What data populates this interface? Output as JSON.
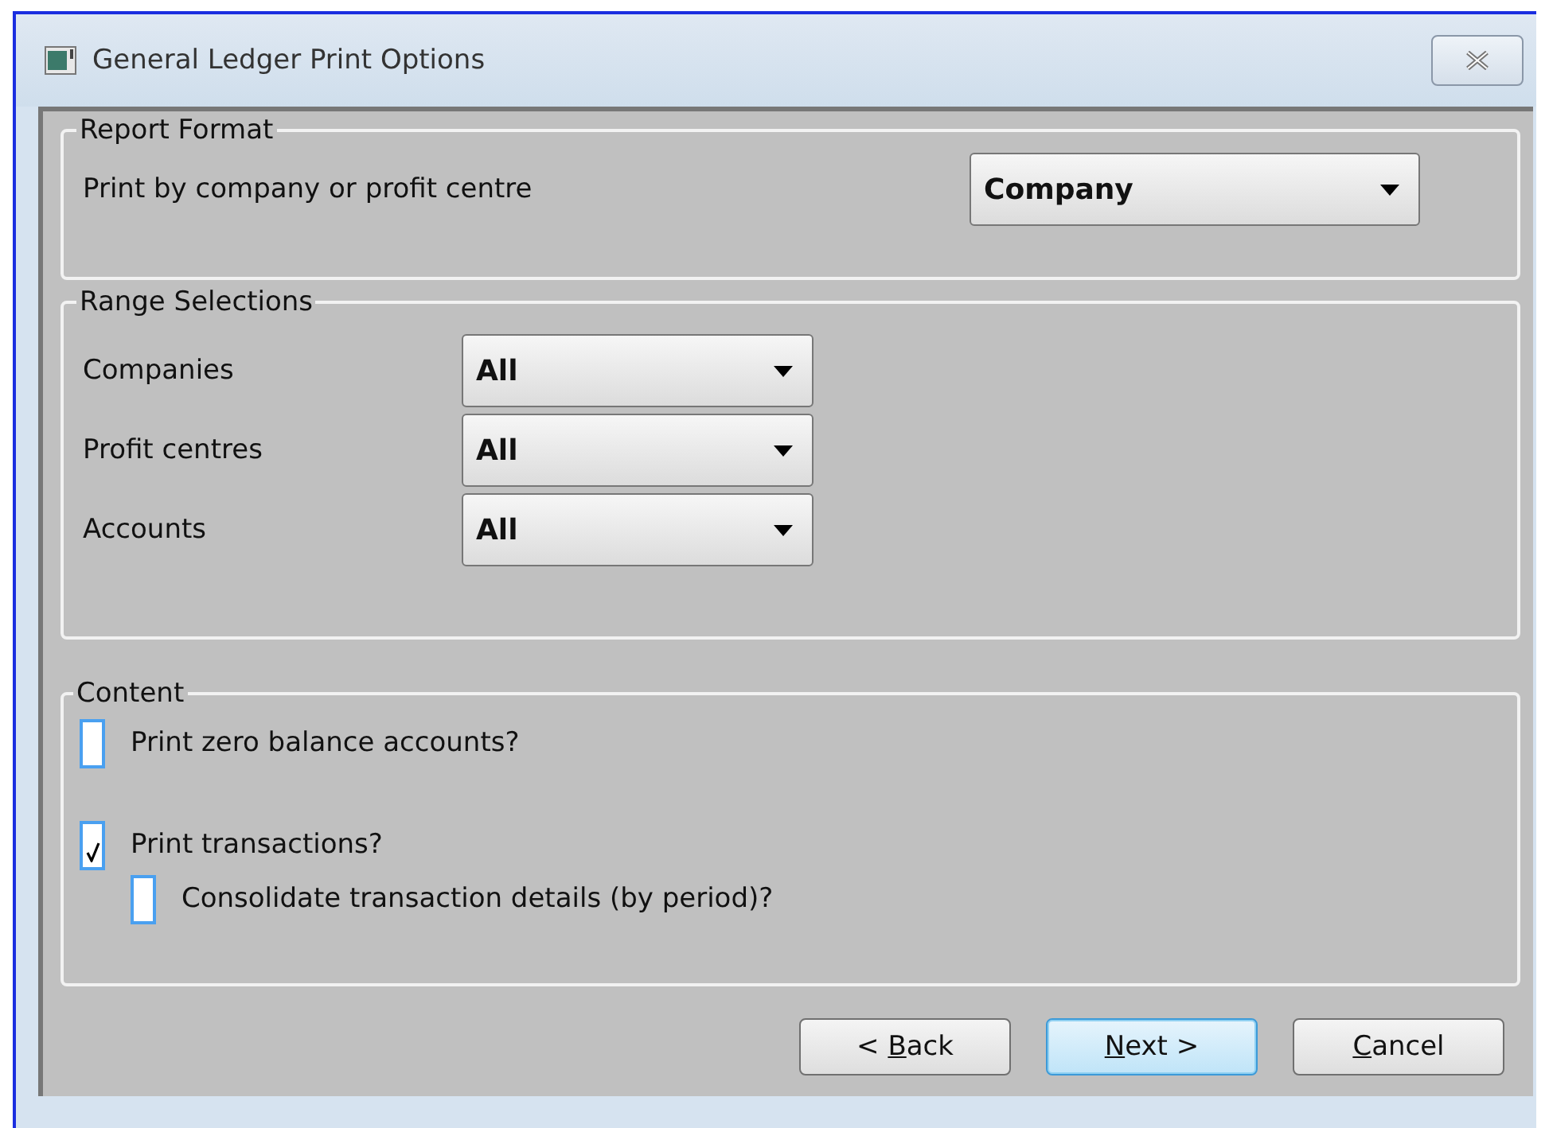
{
  "window": {
    "title": "General Ledger Print Options"
  },
  "report_format": {
    "title": "Report Format",
    "label": "Print by company or profit centre",
    "value": "Company"
  },
  "range_selections": {
    "title": "Range Selections",
    "rows": [
      {
        "label": "Companies",
        "value": "All"
      },
      {
        "label": "Profit centres",
        "value": "All"
      },
      {
        "label": "Accounts",
        "value": "All"
      }
    ]
  },
  "content": {
    "title": "Content",
    "options": [
      {
        "label": "Print zero balance accounts?",
        "checked": false
      },
      {
        "label": "Print transactions?",
        "checked": true,
        "children": [
          {
            "label": "Consolidate transaction details (by period)?",
            "checked": false
          }
        ]
      }
    ]
  },
  "buttons": [
    {
      "before": "< ",
      "key": "B",
      "after": "ack",
      "default": false
    },
    {
      "key": "N",
      "after": "ext >",
      "default": true
    },
    {
      "key": "C",
      "after": "ancel",
      "default": false
    }
  ]
}
